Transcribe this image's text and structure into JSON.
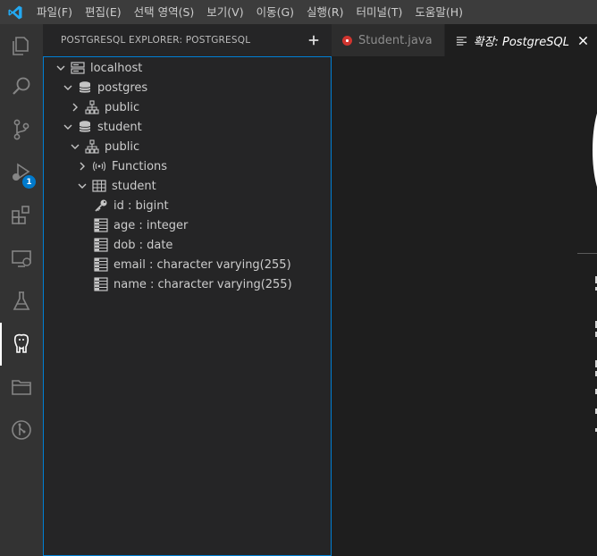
{
  "menu": {
    "items": [
      "파일(F)",
      "편집(E)",
      "선택 영역(S)",
      "보기(V)",
      "이동(G)",
      "실행(R)",
      "터미널(T)",
      "도움말(H)"
    ]
  },
  "activity_bar": {
    "debug_badge": "1"
  },
  "sidebar": {
    "title": "POSTGRESQL EXPLORER: POSTGRESQL",
    "tree": [
      {
        "label": "localhost",
        "icon": "server-icon",
        "depth": 0,
        "expanded": true
      },
      {
        "label": "postgres",
        "icon": "database-icon",
        "depth": 1,
        "expanded": true
      },
      {
        "label": "public",
        "icon": "schema-icon",
        "depth": 2,
        "expanded": false
      },
      {
        "label": "student",
        "icon": "database-icon",
        "depth": 1,
        "expanded": true
      },
      {
        "label": "public",
        "icon": "schema-icon",
        "depth": 2,
        "expanded": true
      },
      {
        "label": "Functions",
        "icon": "functions-icon",
        "depth": 3,
        "expanded": false
      },
      {
        "label": "student",
        "icon": "table-icon",
        "depth": 3,
        "expanded": true
      },
      {
        "label": "id : bigint",
        "icon": "key-icon",
        "depth": 4,
        "expanded": null
      },
      {
        "label": "age : integer",
        "icon": "column-icon",
        "depth": 4,
        "expanded": null
      },
      {
        "label": "dob : date",
        "icon": "column-icon",
        "depth": 4,
        "expanded": null
      },
      {
        "label": "email : character varying(255)",
        "icon": "column-icon",
        "depth": 4,
        "expanded": null
      },
      {
        "label": "name : character varying(255)",
        "icon": "column-icon",
        "depth": 4,
        "expanded": null
      }
    ]
  },
  "tabs": [
    {
      "label": "Student.java",
      "active": false
    },
    {
      "label": "확장: PostgreSQL",
      "active": true
    }
  ],
  "colors": {
    "accent": "#007acc",
    "focus_border": "#007fd4",
    "java_icon": "#d0352f"
  }
}
